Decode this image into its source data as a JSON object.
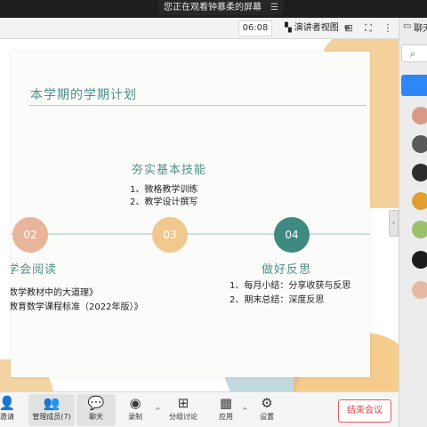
{
  "banner": {
    "text": "您正在观看钟慕柔的屏幕",
    "menu_icon": "menu-lines-icon"
  },
  "toolbar": {
    "time": "06:08",
    "view_label": "演讲者视图",
    "view_icon": "presenter-view-icon",
    "icons": [
      "grid-icon",
      "fullscreen-icon",
      "more-icon"
    ]
  },
  "slide": {
    "title": "本学期的学期计划",
    "top_block": {
      "heading": "夯实基本技能",
      "items": [
        "1、微格教学训练",
        "2、教学设计撰写"
      ]
    },
    "steps": [
      "02",
      "03",
      "04"
    ],
    "left_block": {
      "heading": "学会阅读",
      "items": [
        "学数学教材中的大道理》",
        "务教育数学课程标准（2022年版）》"
      ]
    },
    "right_block": {
      "heading": "做好反思",
      "items": [
        "1、每月小结：分享收获与反思",
        "2、期末总结：深度反思"
      ]
    }
  },
  "right_panel": {
    "chat_label": "聊天"
  },
  "bottom_bar": {
    "items": [
      {
        "label": "邀请",
        "icon": "invite-icon"
      },
      {
        "label": "管理成员(7)",
        "icon": "members-icon"
      },
      {
        "label": "聊天",
        "icon": "chat-icon"
      },
      {
        "label": "录制",
        "icon": "record-icon"
      },
      {
        "label": "分组讨论",
        "icon": "breakout-icon"
      },
      {
        "label": "应用",
        "icon": "apps-icon"
      },
      {
        "label": "设置",
        "icon": "settings-icon"
      }
    ],
    "end_label": "结束会议"
  },
  "colors": {
    "accent": "#2f86f6",
    "title_green": "#4d8f8a",
    "end_red": "#e14848"
  }
}
